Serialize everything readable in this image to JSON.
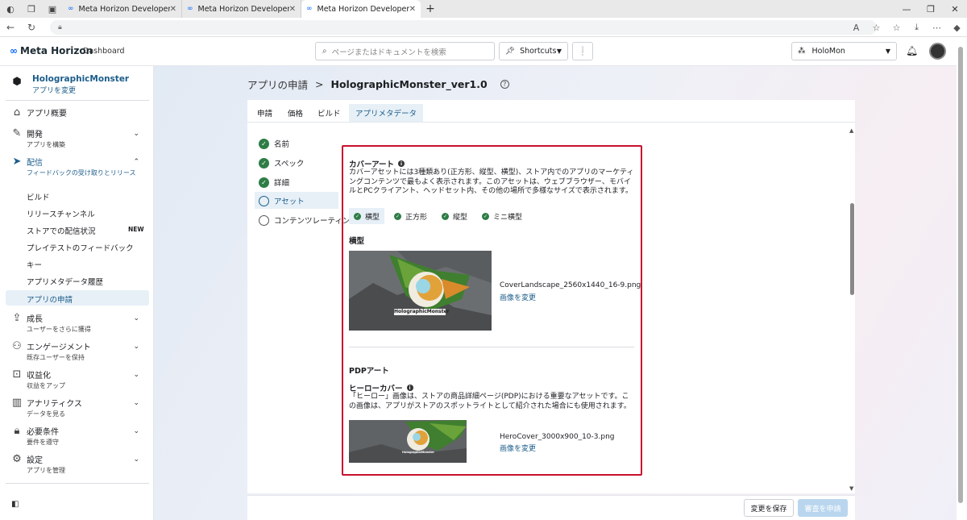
{
  "browser": {
    "tabs": [
      {
        "title": "Meta Horizon Developers",
        "active": false
      },
      {
        "title": "Meta Horizon Developers",
        "active": false
      },
      {
        "title": "Meta Horizon Developers",
        "active": true
      }
    ]
  },
  "header": {
    "brand": "Meta Horizon",
    "section": "Dashboard",
    "search_placeholder": "ページまたはドキュメントを検索",
    "shortcuts_label": "Shortcuts",
    "org_name": "HoloMon"
  },
  "sidebar": {
    "app_name": "HolographicMonster",
    "app_change": "アプリを変更",
    "overview": "アプリ概要",
    "develop": {
      "label": "開発",
      "sub": "アプリを構築"
    },
    "distribute": {
      "label": "配信",
      "sub": "フィードバックの受け取りとリリース"
    },
    "distribute_items": [
      "ビルド",
      "リリースチャンネル",
      "ストアでの配信状況",
      "プレイテストのフィードバック",
      "キー",
      "アプリメタデータ履歴",
      "アプリの申請"
    ],
    "new_badge": "NEW",
    "grow": {
      "label": "成長",
      "sub": "ユーザーをさらに獲得"
    },
    "engage": {
      "label": "エンゲージメント",
      "sub": "既存ユーザーを保持"
    },
    "monetize": {
      "label": "収益化",
      "sub": "収益をアップ"
    },
    "analytics": {
      "label": "アナリティクス",
      "sub": "データを見る"
    },
    "requirements": {
      "label": "必要条件",
      "sub": "要件を遵守"
    },
    "settings": {
      "label": "設定",
      "sub": "アプリを管理"
    }
  },
  "breadcrumb": {
    "parent": "アプリの申請",
    "separator": ">",
    "current": "HolographicMonster_ver1.0"
  },
  "content_tabs": [
    "申請",
    "価格",
    "ビルド",
    "アプリメタデータ"
  ],
  "steps": [
    {
      "label": "名前",
      "done": true
    },
    {
      "label": "スペック",
      "done": true
    },
    {
      "label": "詳細",
      "done": true
    },
    {
      "label": "アセット",
      "done": false
    },
    {
      "label": "コンテンツレーティング",
      "done": false
    }
  ],
  "cover_art": {
    "title": "カバーアート",
    "description": "カバーアセットには3種類あり(正方形、縦型、横型)、ストア内でのアプリのマーケティングコンテンツで最もよく表示されます。このアセットは、ウェブブラウザー、モバイルとPCクライアント、ヘッドセット内、その他の場所で多様なサイズで表示されます。",
    "chips": [
      "横型",
      "正方形",
      "縦型",
      "ミニ横型"
    ],
    "landscape_heading": "横型",
    "landscape_image_text": "HolographicMonster",
    "landscape_file": "CoverLandscape_2560x1440_16-9.png",
    "change_label": "画像を変更"
  },
  "pdp_art": {
    "title": "PDPアート",
    "hero_title": "ヒーローカバー",
    "hero_description": "「ヒーロー」画像は、ストアの商品詳細ページ(PDP)における重要なアセットです。この画像は、アプリがストアのスポットライトとして紹介された場合にも使用されます。",
    "hero_image_text": "HolographicMonster",
    "hero_file": "HeroCover_3000x900_10-3.png",
    "change_label": "画像を変更"
  },
  "footer": {
    "save_label": "変更を保存",
    "submit_label": "審査を申請"
  },
  "colors": {
    "link_blue": "#1c5d8a",
    "check_green": "#2e7d46",
    "highlight_red": "#c8102e"
  }
}
